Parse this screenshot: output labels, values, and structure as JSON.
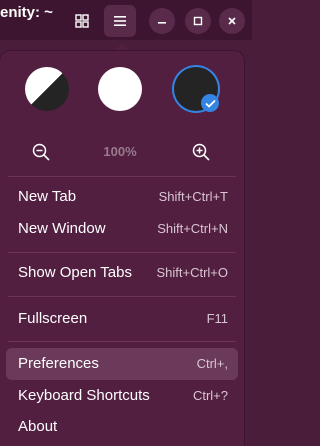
{
  "window": {
    "title": "enity: ~"
  },
  "header": {
    "grid_icon": "grid-icon",
    "menu_icon": "hamburger-menu-icon",
    "minimize_icon": "minimize-icon",
    "maximize_icon": "maximize-icon",
    "close_icon": "close-icon"
  },
  "menu": {
    "themes": [
      {
        "name": "follow-system",
        "selected": false
      },
      {
        "name": "light",
        "selected": false
      },
      {
        "name": "dark",
        "selected": true
      }
    ],
    "zoom": {
      "level": "100%"
    },
    "items": [
      {
        "label": "New Tab",
        "accel": "Shift+Ctrl+T"
      },
      {
        "label": "New Window",
        "accel": "Shift+Ctrl+N"
      },
      {
        "label": "Show Open Tabs",
        "accel": "Shift+Ctrl+O"
      },
      {
        "label": "Fullscreen",
        "accel": "F11"
      },
      {
        "label": "Preferences",
        "accel": "Ctrl+,"
      },
      {
        "label": "Keyboard Shortcuts",
        "accel": "Ctrl+?"
      },
      {
        "label": "About",
        "accel": ""
      }
    ]
  },
  "colors": {
    "background": "#4a1e3a",
    "popover": "#521f40",
    "accent": "#3584e4",
    "hover": "#6b3a5a"
  }
}
